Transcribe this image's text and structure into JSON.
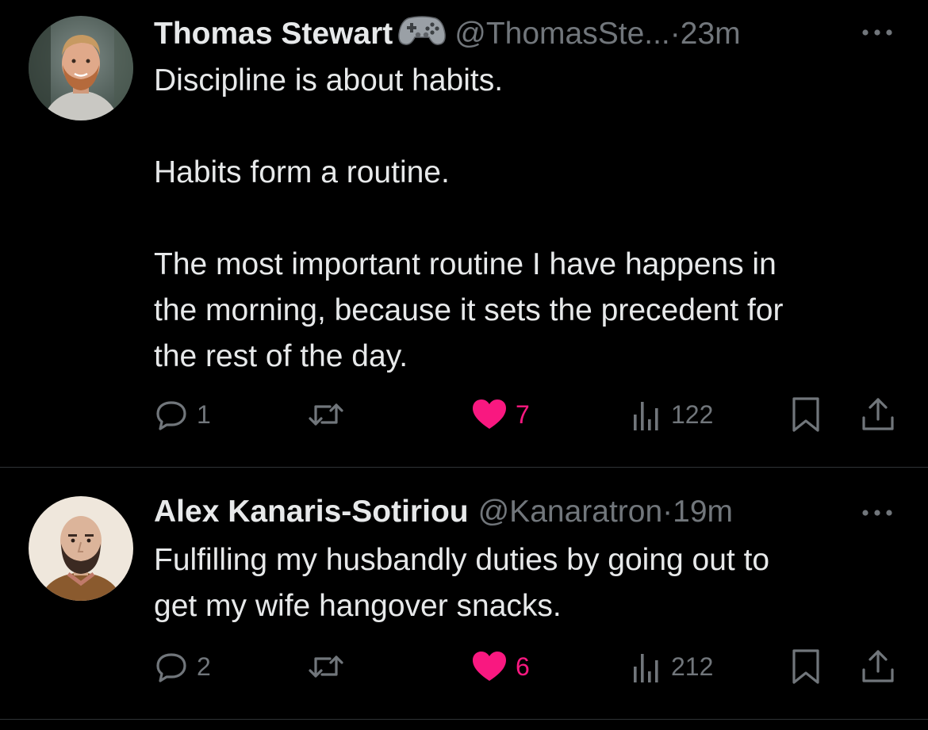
{
  "colors": {
    "background": "#000000",
    "text_primary": "#e7e9ea",
    "text_secondary": "#71767b",
    "like_active": "#f91880",
    "divider": "#2f3336"
  },
  "tweets": [
    {
      "author_name": "Thomas Stewart",
      "badge_icon": "game-controller-icon",
      "handle": "@ThomasSte...",
      "separator": "·",
      "time": "23m",
      "body": [
        "Discipline is about habits.",
        "",
        "Habits form a routine.",
        "",
        "The most important routine I have happens in",
        "the morning, because it sets the precedent for",
        "the rest of the day."
      ],
      "actions": {
        "replies": "1",
        "reposts": "",
        "likes": "7",
        "views": "122"
      },
      "liked": true
    },
    {
      "author_name": "Alex Kanaris-Sotiriou",
      "handle": "@Kanaratron",
      "separator": "·",
      "time": "19m",
      "body": [
        "Fulfilling my husbandly duties by going out to",
        "get my wife hangover snacks."
      ],
      "actions": {
        "replies": "2",
        "reposts": "",
        "likes": "6",
        "views": "212"
      },
      "liked": true
    }
  ]
}
